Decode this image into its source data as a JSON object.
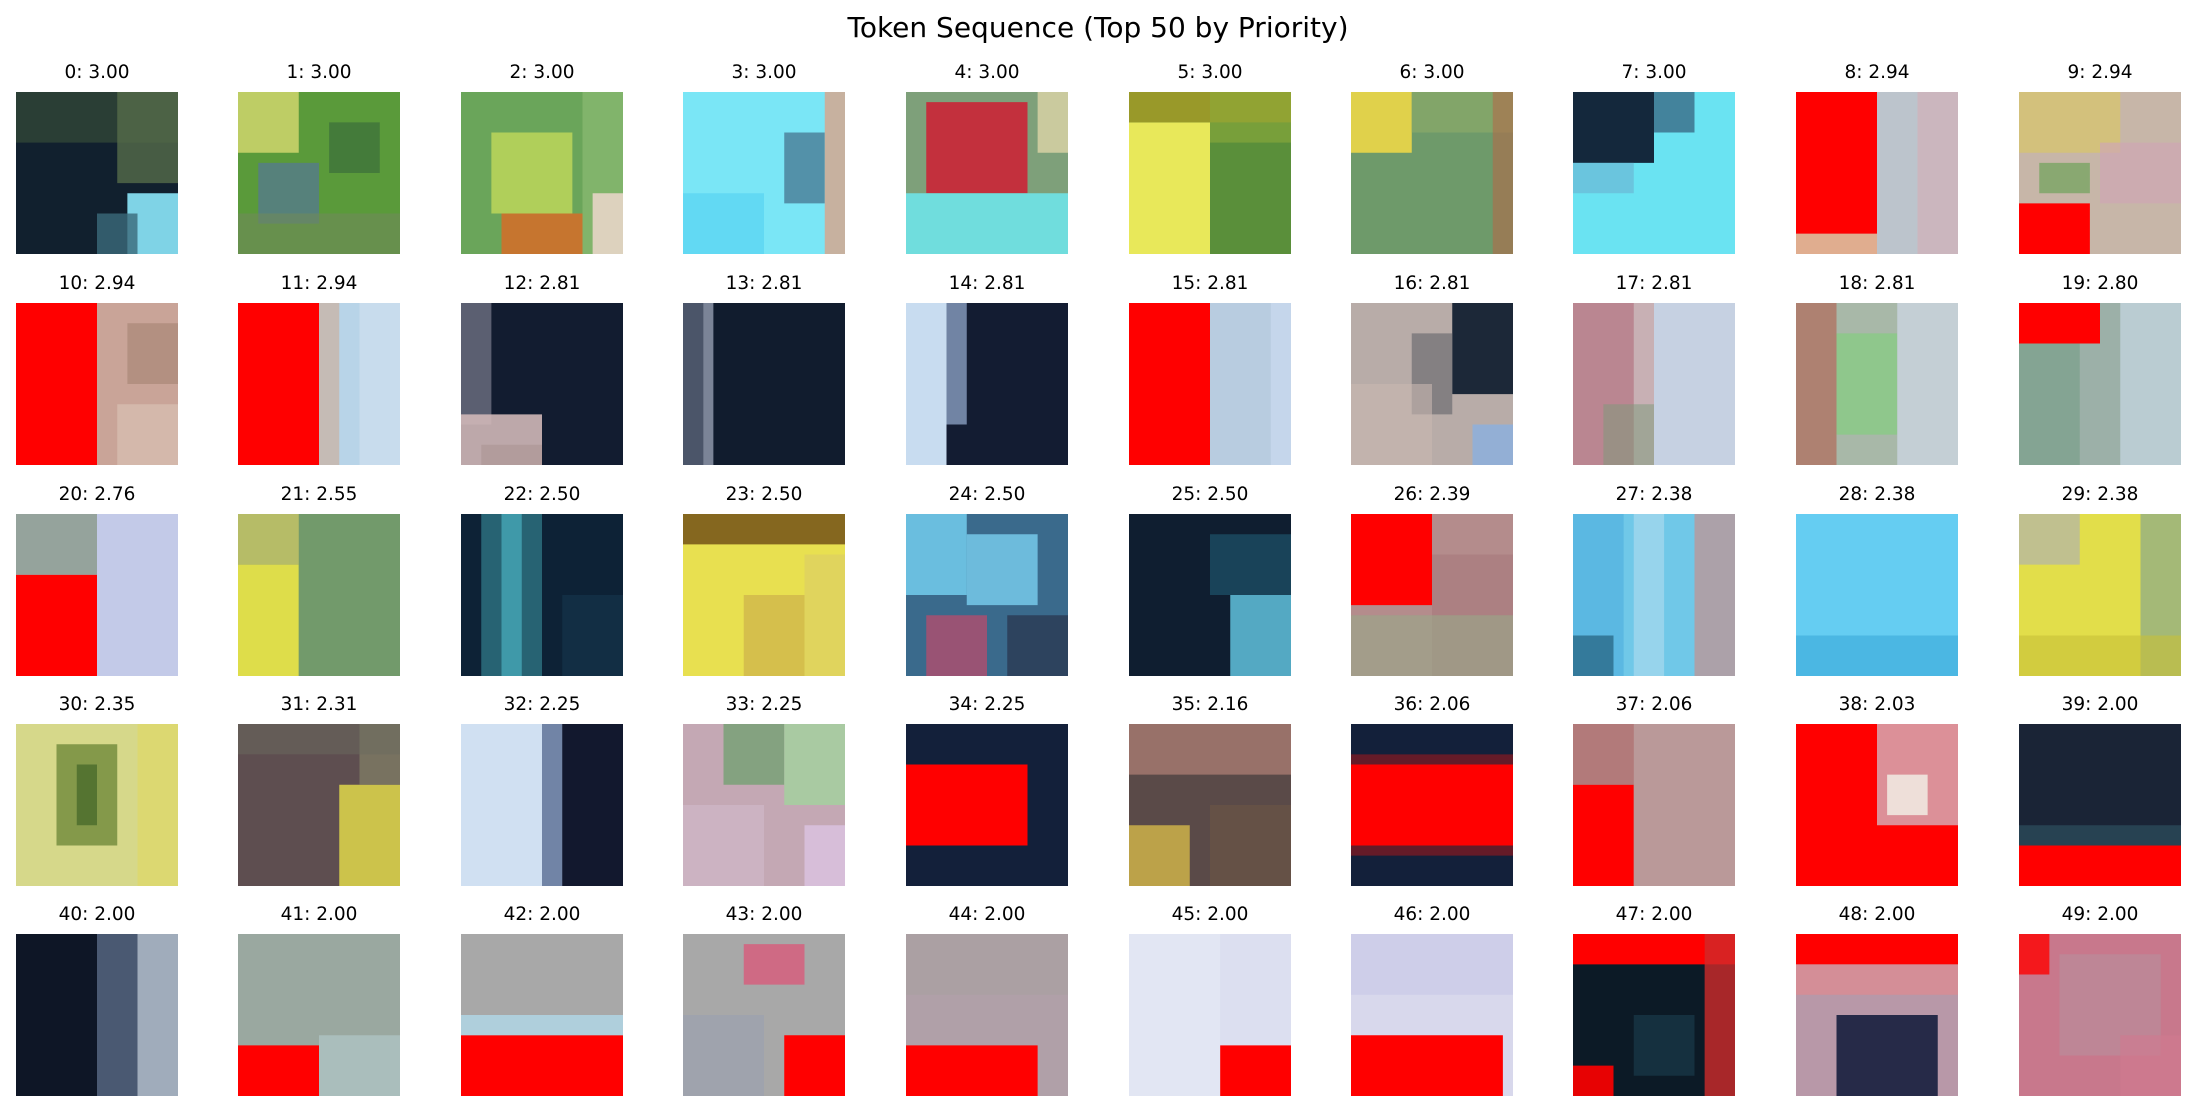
{
  "title": "Token Sequence (Top 50 by Priority)",
  "tokens": [
    {
      "index": 0,
      "label": "0: 3.00",
      "patch": "dark navy with olive-green top and light-blue lower-right corner"
    },
    {
      "index": 1,
      "label": "1: 3.00",
      "patch": "green foliage with yellow-green top-left and blue-grey blotches"
    },
    {
      "index": 2,
      "label": "2: 3.00",
      "patch": "green with yellow-lime centre and orange-red bottom"
    },
    {
      "index": 3,
      "label": "3: 3.00",
      "patch": "light cyan with a dark blue spot on the right"
    },
    {
      "index": 4,
      "label": "4: 3.00",
      "patch": "red blob on grey-green with cyan bottom"
    },
    {
      "index": 5,
      "label": "5: 3.00",
      "patch": "yellow left half, green right half, olive top"
    },
    {
      "index": 6,
      "label": "6: 3.00",
      "patch": "yellow top-left over sage green"
    },
    {
      "index": 7,
      "label": "7: 3.00",
      "patch": "dark navy top-left fading into light cyan"
    },
    {
      "index": 8,
      "label": "8: 2.94",
      "patch": "red rectangle on left, light grey-blue right"
    },
    {
      "index": 9,
      "label": "9: 2.94",
      "patch": "mixed pastel with red block bottom-left"
    },
    {
      "index": 10,
      "label": "10: 2.94",
      "patch": "red left half, pinkish beige right"
    },
    {
      "index": 11,
      "label": "11: 2.94",
      "patch": "red block left, pale blue right"
    },
    {
      "index": 12,
      "label": "12: 2.81",
      "patch": "dark navy with pale pinkish corner bottom-left"
    },
    {
      "index": 13,
      "label": "13: 2.81",
      "patch": "dark navy with a pale stripe at left"
    },
    {
      "index": 14,
      "label": "14: 2.81",
      "patch": "pale blue diagonal stripe into dark navy"
    },
    {
      "index": 15,
      "label": "15: 2.81",
      "patch": "red left half, light blue right"
    },
    {
      "index": 16,
      "label": "16: 2.81",
      "patch": "beige/greyish with dark blue on the right"
    },
    {
      "index": 17,
      "label": "17: 2.81",
      "patch": "pinkish grey left to pale blue right"
    },
    {
      "index": 18,
      "label": "18: 2.81",
      "patch": "pink and green diagonal streaks"
    },
    {
      "index": 19,
      "label": "19: 2.80",
      "patch": "red strip top, green-grey and pale blue bands"
    },
    {
      "index": 20,
      "label": "20: 2.76",
      "patch": "red block bottom-left, lavender-blue right"
    },
    {
      "index": 21,
      "label": "21: 2.55",
      "patch": "yellow left, sage green right diagonal"
    },
    {
      "index": 22,
      "label": "22: 2.50",
      "patch": "dark navy with teal diagonal stripe"
    },
    {
      "index": 23,
      "label": "23: 2.50",
      "patch": "bright yellow with dark olive top"
    },
    {
      "index": 24,
      "label": "24: 2.50",
      "patch": "teal, cyan and pink swirl on dark"
    },
    {
      "index": 25,
      "label": "25: 2.50",
      "patch": "dark navy with teal lower-right"
    },
    {
      "index": 26,
      "label": "26: 2.39",
      "patch": "red square top-left on grey-pink"
    },
    {
      "index": 27,
      "label": "27: 2.38",
      "patch": "light sky blue with pale streaks"
    },
    {
      "index": 28,
      "label": "28: 2.38",
      "patch": "uniform sky blue"
    },
    {
      "index": 29,
      "label": "29: 2.38",
      "patch": "yellow with grey top-left and green-grey right"
    },
    {
      "index": 30,
      "label": "30: 2.35",
      "patch": "olive green centre with pale yellow edges"
    },
    {
      "index": 31,
      "label": "31: 2.31",
      "patch": "brown-grey with yellow lower-right"
    },
    {
      "index": 32,
      "label": "32: 2.25",
      "patch": "pale blue left, dark navy right"
    },
    {
      "index": 33,
      "label": "33: 2.25",
      "patch": "pink and green pastel mix"
    },
    {
      "index": 34,
      "label": "34: 2.25",
      "patch": "red rectangle centred on dark navy"
    },
    {
      "index": 35,
      "label": "35: 2.16",
      "patch": "brown with pinkish top and yellow bottom-left"
    },
    {
      "index": 36,
      "label": "36: 2.06",
      "patch": "red horizontal band on dark navy"
    },
    {
      "index": 37,
      "label": "37: 2.06",
      "patch": "red block bottom-left on pinkish grey"
    },
    {
      "index": 38,
      "label": "38: 2.03",
      "patch": "red L-shape around a pale pink square"
    },
    {
      "index": 39,
      "label": "39: 2.00",
      "patch": "dark navy with red band at bottom"
    },
    {
      "index": 40,
      "label": "40: 2.00",
      "patch": "dark navy left with grey-blue right"
    },
    {
      "index": 41,
      "label": "41: 2.00",
      "patch": "grey-green with red block bottom-left"
    },
    {
      "index": 42,
      "label": "42: 2.00",
      "patch": "grey with red band at bottom"
    },
    {
      "index": 43,
      "label": "43: 2.00",
      "patch": "grey with pink top and red bottom-right"
    },
    {
      "index": 44,
      "label": "44: 2.00",
      "patch": "grey-pink with red block bottom-left"
    },
    {
      "index": 45,
      "label": "45: 2.00",
      "patch": "pale lavender with red block bottom-right"
    },
    {
      "index": 46,
      "label": "46: 2.00",
      "patch": "pale lavender with red band at bottom"
    },
    {
      "index": 47,
      "label": "47: 2.00",
      "patch": "red top band with dark navy body"
    },
    {
      "index": 48,
      "label": "48: 2.00",
      "patch": "red band top, pinkish with dark navy lower"
    },
    {
      "index": 49,
      "label": "49: 2.00",
      "patch": "muted pink with red spot top-left"
    }
  ]
}
